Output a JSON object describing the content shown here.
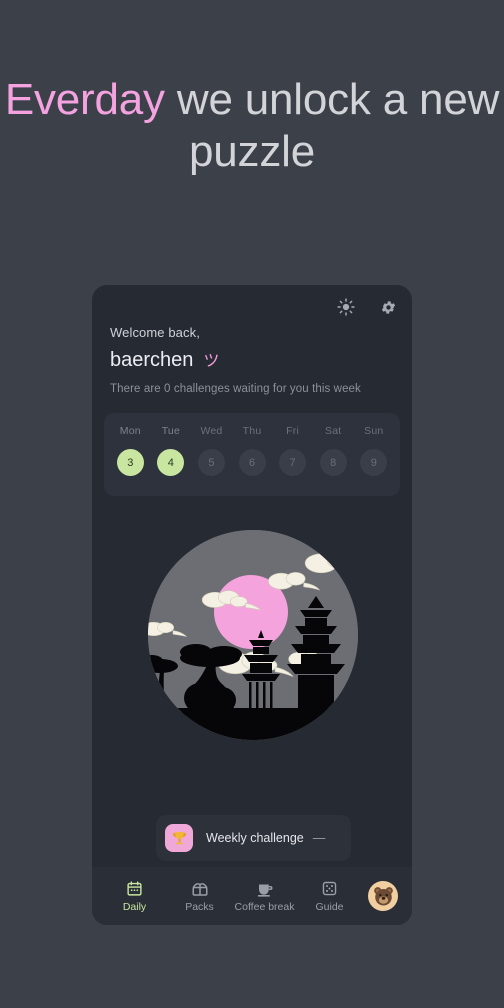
{
  "headline": {
    "accent_word": "Everday",
    "rest": " we unlock a new puzzle",
    "accent_color": "#f5a3e0"
  },
  "card": {
    "top_icons": [
      {
        "name": "brightness-icon",
        "label": "Brightness"
      },
      {
        "name": "settings-icon",
        "label": "Settings"
      }
    ],
    "greeting": {
      "hello": "Welcome back,",
      "username": "baerchen",
      "emoji": "ツ",
      "subtitle": "There are 0 challenges waiting for you this week"
    },
    "week": {
      "days": [
        {
          "name": "Mon",
          "date": "3",
          "active": true
        },
        {
          "name": "Tue",
          "date": "4",
          "active": true
        },
        {
          "name": "Wed",
          "date": "5",
          "active": false
        },
        {
          "name": "Thu",
          "date": "6",
          "active": false
        },
        {
          "name": "Fri",
          "date": "7",
          "active": false
        },
        {
          "name": "Sat",
          "date": "8",
          "active": false
        },
        {
          "name": "Sun",
          "date": "9",
          "active": false
        }
      ],
      "active_color": "#c8e6a0",
      "inactive_color": "#3a3e48"
    },
    "illustration": {
      "name": "japanese-night-scene",
      "moon_color": "#f5a3dd",
      "sky_color": "#6c6e74",
      "cloud_color": "#f4f1e4",
      "silhouette_color": "#060608"
    },
    "challenge": {
      "label": "Weekly challenge",
      "dash": "—",
      "icon": "trophy-icon",
      "icon_bg": "#f0a8d9"
    },
    "nav": {
      "items": [
        {
          "label": "Daily",
          "icon": "calendar-icon",
          "active": true
        },
        {
          "label": "Packs",
          "icon": "gift-box-icon",
          "active": false
        },
        {
          "label": "Coffee break",
          "icon": "coffee-cup-icon",
          "active": false
        },
        {
          "label": "Guide",
          "icon": "dice-icon",
          "active": false
        }
      ],
      "avatar": {
        "name": "bear-avatar",
        "bg": "#f2cfa0"
      }
    }
  }
}
